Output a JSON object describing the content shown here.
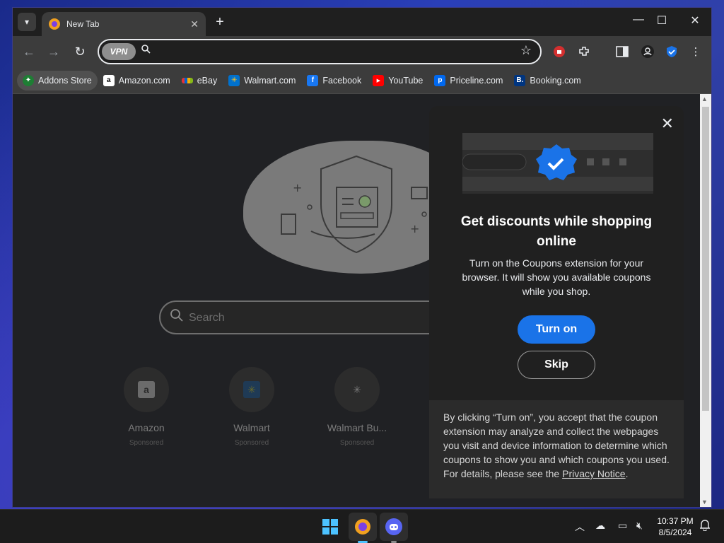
{
  "window": {
    "tab_title": "New Tab",
    "controls": {
      "minimize": "—",
      "maximize": "☐",
      "close": "✕"
    }
  },
  "toolbar": {
    "vpn_label": "VPN",
    "omnibox_placeholder": ""
  },
  "bookmarks": [
    {
      "label": "Addons Store",
      "icon": "addons-store-icon",
      "color": "#1e7e34"
    },
    {
      "label": "Amazon.com",
      "icon": "amazon-icon",
      "color": "#ffffff"
    },
    {
      "label": "eBay",
      "icon": "ebay-icon",
      "color": "#e53238"
    },
    {
      "label": "Walmart.com",
      "icon": "walmart-icon",
      "color": "#0071ce"
    },
    {
      "label": "Facebook",
      "icon": "facebook-icon",
      "color": "#1877f2"
    },
    {
      "label": "YouTube",
      "icon": "youtube-icon",
      "color": "#ff0000"
    },
    {
      "label": "Priceline.com",
      "icon": "priceline-icon",
      "color": "#0068ef"
    },
    {
      "label": "Booking.com",
      "icon": "booking-icon",
      "color": "#003580"
    }
  ],
  "newtab": {
    "search_placeholder": "Search",
    "tiles": [
      {
        "name": "Amazon",
        "sponsored": "Sponsored"
      },
      {
        "name": "Walmart",
        "sponsored": "Sponsored"
      },
      {
        "name": "Walmart Bu...",
        "sponsored": "Sponsored"
      }
    ]
  },
  "popup": {
    "title": "Get discounts while shopping online",
    "description": "Turn on the Coupons extension for your browser. It will show you available coupons while you shop.",
    "turn_on_label": "Turn on",
    "skip_label": "Skip",
    "footer_text": "By clicking “Turn on”, you accept that the coupon extension may analyze and collect the webpages you visit and device information to determine which coupons to show you and which coupons you used. For details, please see the ",
    "privacy_link": "Privacy Notice",
    "footer_end": "."
  },
  "taskbar": {
    "time": "10:37 PM",
    "date": "8/5/2024"
  },
  "colors": {
    "accent": "#1a73e8",
    "popup_bg": "#202020",
    "page_bg": "#202124"
  }
}
